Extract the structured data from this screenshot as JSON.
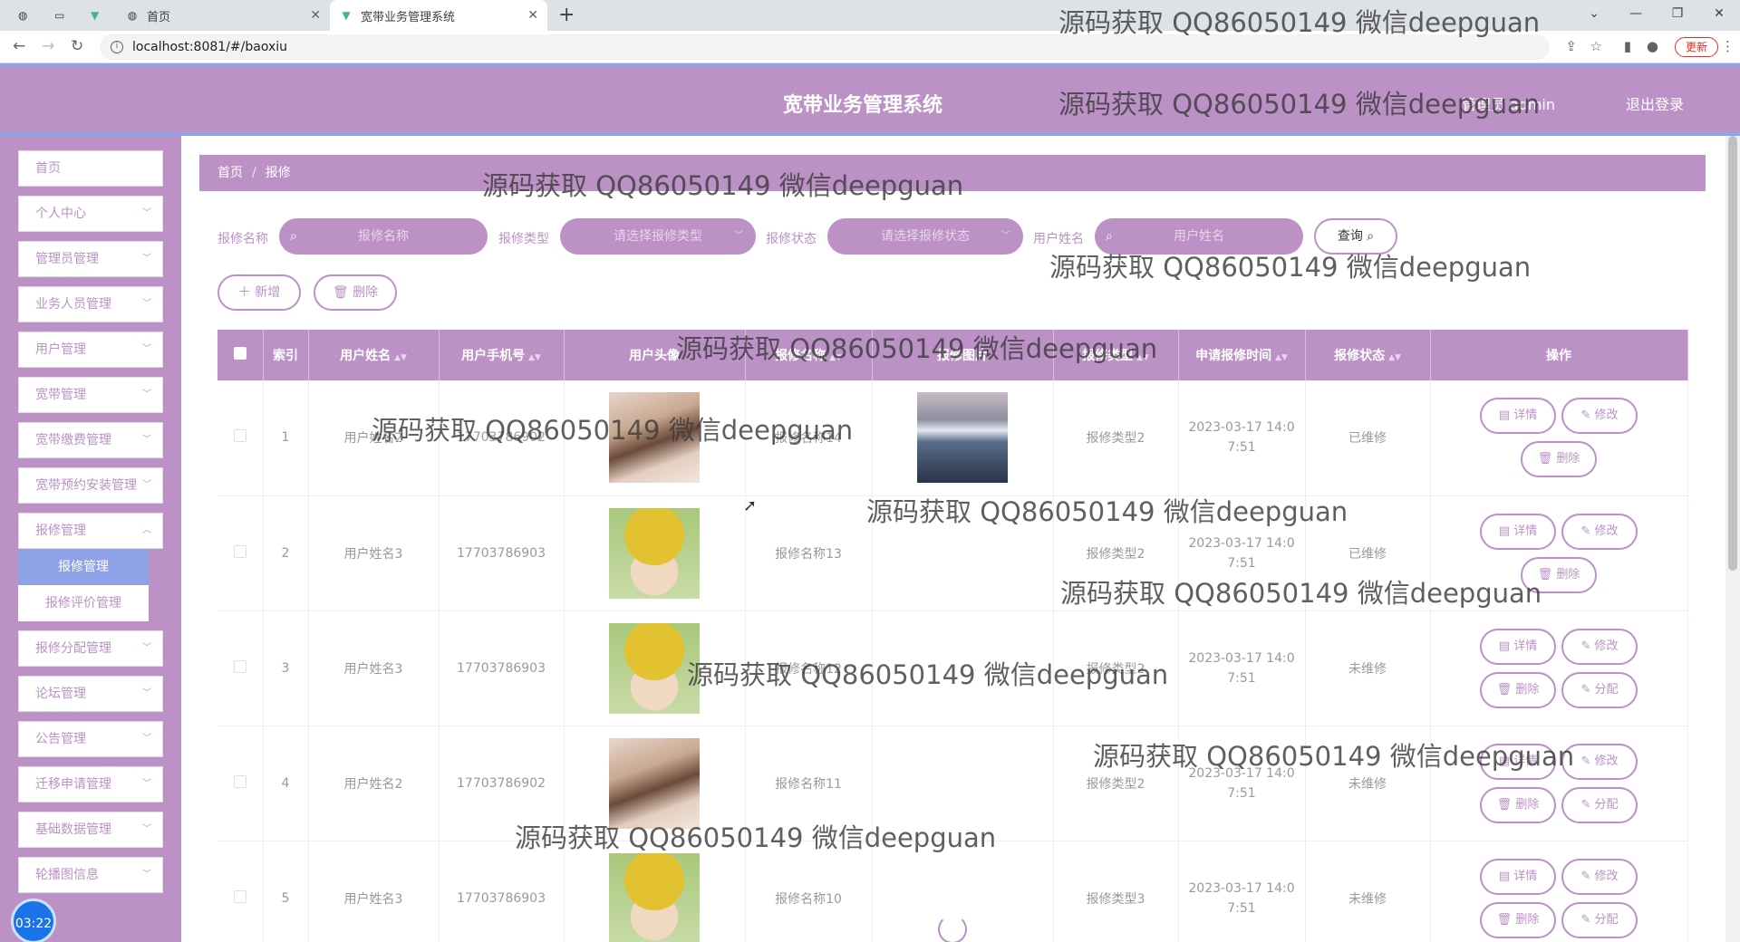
{
  "browser": {
    "tabs": [
      {
        "label": ""
      },
      {
        "label": ""
      },
      {
        "label": ""
      },
      {
        "label": "首页"
      },
      {
        "label": "宽带业务管理系统"
      }
    ],
    "url": "localhost:8081/#/baoxiu",
    "update_label": "更新"
  },
  "header": {
    "title": "宽带业务管理系统",
    "user": "管理员 admin",
    "logout": "退出登录"
  },
  "sidebar": {
    "items": [
      {
        "label": "首页"
      },
      {
        "label": "个人中心"
      },
      {
        "label": "管理员管理"
      },
      {
        "label": "业务人员管理"
      },
      {
        "label": "用户管理"
      },
      {
        "label": "宽带管理"
      },
      {
        "label": "宽带缴费管理"
      },
      {
        "label": "宽带预约安装管理"
      },
      {
        "label": "报修管理"
      },
      {
        "label": "报修分配管理"
      },
      {
        "label": "论坛管理"
      },
      {
        "label": "公告管理"
      },
      {
        "label": "迁移申请管理"
      },
      {
        "label": "基础数据管理"
      },
      {
        "label": "轮播图信息"
      }
    ],
    "submenu": [
      {
        "label": "报修管理"
      },
      {
        "label": "报修评价管理"
      }
    ]
  },
  "timer": "03:22",
  "breadcrumb": {
    "home": "首页",
    "current": "报修"
  },
  "filters": {
    "name_label": "报修名称",
    "name_placeholder": "报修名称",
    "type_label": "报修类型",
    "type_placeholder": "请选择报修类型",
    "status_label": "报修状态",
    "status_placeholder": "请选择报修状态",
    "user_label": "用户姓名",
    "user_placeholder": "用户姓名",
    "query": "查询"
  },
  "actions": {
    "add": "新增",
    "delete": "删除"
  },
  "table": {
    "headers": [
      "索引",
      "用户姓名",
      "用户手机号",
      "用户头像",
      "报修名称",
      "报修图片",
      "报修类型",
      "申请报修时间",
      "报修状态",
      "操作"
    ],
    "rows": [
      {
        "index": "1",
        "name": "用户姓名2",
        "phone": "17703786902",
        "avatar": "girl",
        "title": "报修名称14",
        "photo": "city",
        "type": "报修类型2",
        "time1": "2023-03-17 14:0",
        "time2": "7:51",
        "status": "已维修",
        "assign": false
      },
      {
        "index": "2",
        "name": "用户姓名3",
        "phone": "17703786903",
        "avatar": "boy",
        "title": "报修名称13",
        "photo": "",
        "type": "报修类型2",
        "time1": "2023-03-17 14:0",
        "time2": "7:51",
        "status": "已维修",
        "assign": false
      },
      {
        "index": "3",
        "name": "用户姓名3",
        "phone": "17703786903",
        "avatar": "boy",
        "title": "报修名称12",
        "photo": "",
        "type": "报修类型2",
        "time1": "2023-03-17 14:0",
        "time2": "7:51",
        "status": "未维修",
        "assign": true
      },
      {
        "index": "4",
        "name": "用户姓名2",
        "phone": "17703786902",
        "avatar": "girl",
        "title": "报修名称11",
        "photo": "",
        "type": "报修类型2",
        "time1": "2023-03-17 14:0",
        "time2": "7:51",
        "status": "未维修",
        "assign": true
      },
      {
        "index": "5",
        "name": "用户姓名3",
        "phone": "17703786903",
        "avatar": "boy",
        "title": "报修名称10",
        "photo": "",
        "type": "报修类型3",
        "time1": "2023-03-17 14:0",
        "time2": "7:51",
        "status": "未维修",
        "assign": true
      }
    ],
    "op_detail": "详情",
    "op_edit": "修改",
    "op_delete": "删除",
    "op_assign": "分配"
  },
  "watermark": "源码获取 QQ86050149 微信deepguan",
  "colors": {
    "primary": "#bb91c6",
    "accent": "#8ea2e8"
  }
}
